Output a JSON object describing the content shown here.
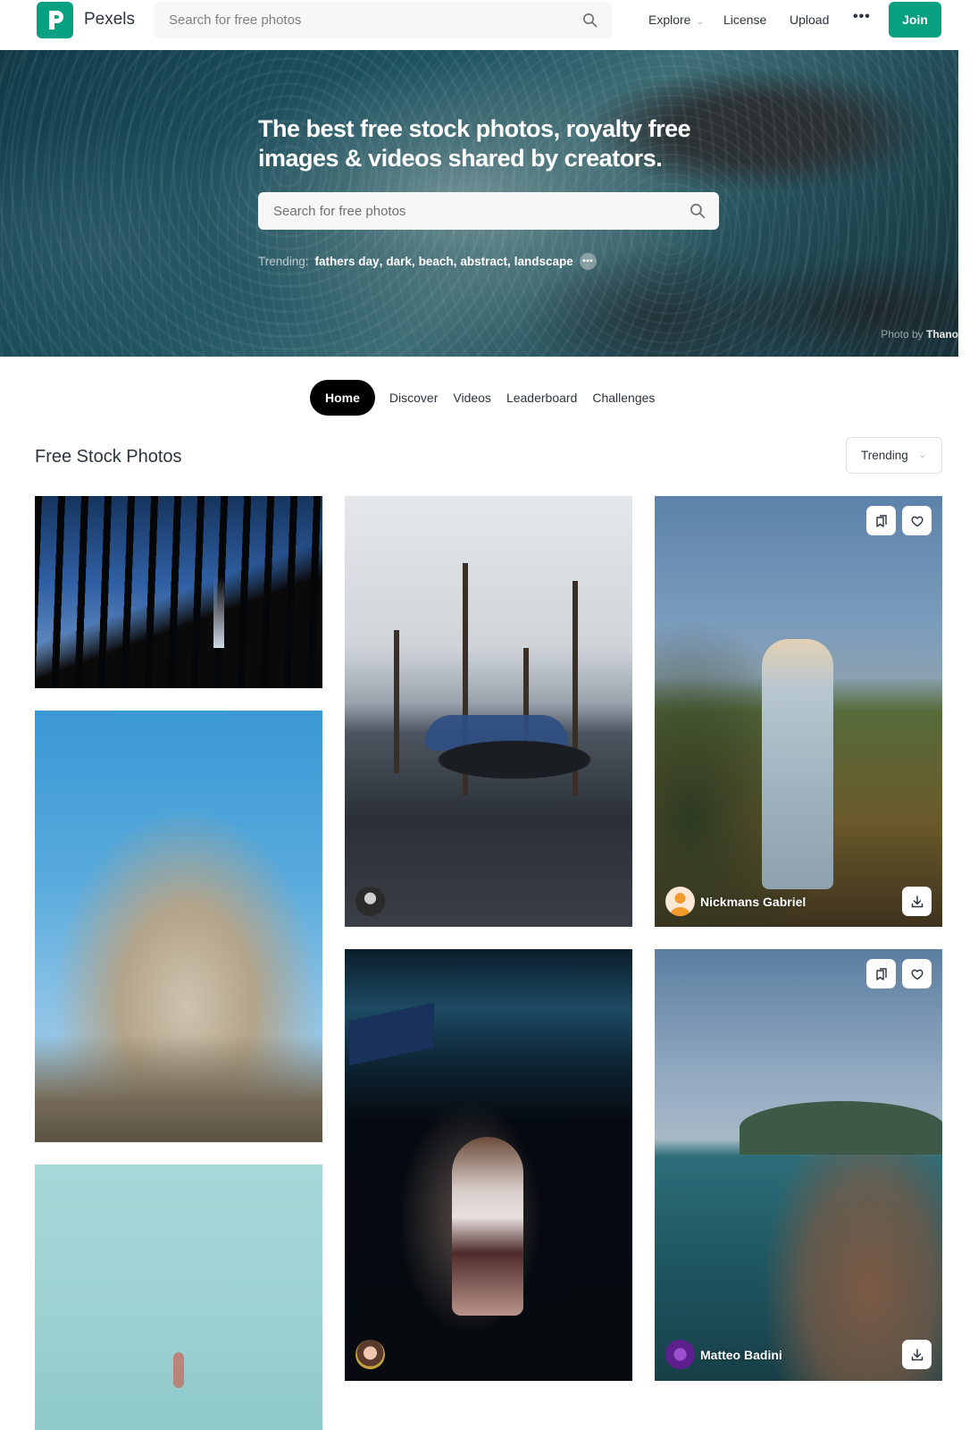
{
  "header": {
    "brand": "Pexels",
    "search_placeholder": "Search for free photos",
    "nav": {
      "explore": "Explore",
      "license": "License",
      "upload": "Upload",
      "more": "•••"
    },
    "join_label": "Join"
  },
  "hero": {
    "title": "The best free stock photos, royalty free images & videos shared by creators.",
    "search_placeholder": "Search for free photos",
    "trending_label": "Trending:",
    "trending_tags": [
      "fathers day",
      "dark",
      "beach",
      "abstract",
      "landscape"
    ],
    "more_label": "•••",
    "credit_prefix": "Photo by",
    "credit_name": "Thano"
  },
  "tabs": [
    {
      "label": "Home",
      "active": true
    },
    {
      "label": "Discover",
      "active": false
    },
    {
      "label": "Videos",
      "active": false
    },
    {
      "label": "Leaderboard",
      "active": false
    },
    {
      "label": "Challenges",
      "active": false
    }
  ],
  "section": {
    "title": "Free Stock Photos",
    "sort_selected": "Trending"
  },
  "photos": [
    {
      "subject": "forest silhouette with lighthouse beam"
    },
    {
      "subject": "gondolas in Venice"
    },
    {
      "subject": "man in denim jacket on hill",
      "author": "Nickmans Gabriel"
    },
    {
      "subject": "rock formation against blue sky"
    },
    {
      "subject": "woman in car at night"
    },
    {
      "subject": "swimmer in turquoise water"
    },
    {
      "subject": "coastal village on cliff",
      "author": "Matteo Badini"
    }
  ],
  "colors": {
    "brand": "#07a081",
    "text": "#2c343e",
    "active_tab_bg": "#000000"
  }
}
